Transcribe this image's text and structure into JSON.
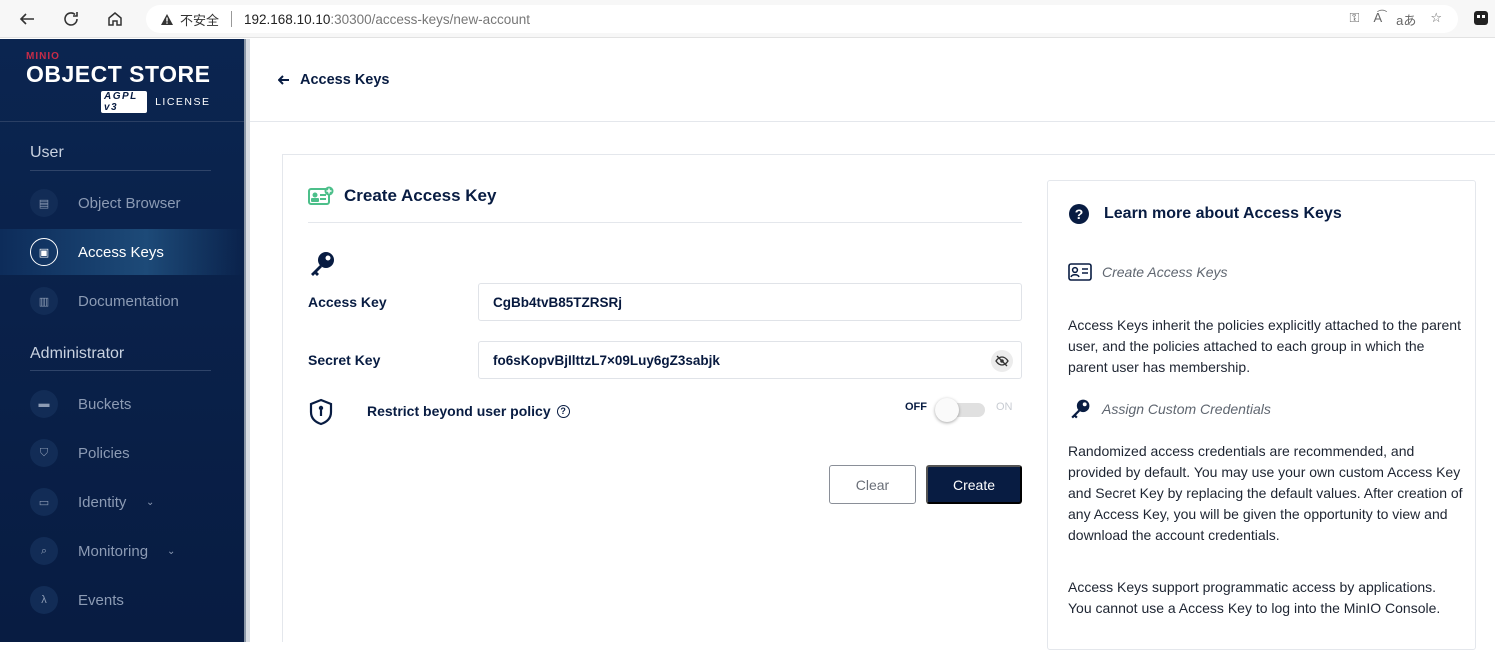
{
  "browser": {
    "security_label": "不安全",
    "url_host": "192.168.10.10",
    "url_path": ":30300/access-keys/new-account"
  },
  "brand": {
    "minio": "MINIO",
    "product": "OBJECT STORE",
    "license_badge": "AGPL v3",
    "license": "LICENSE"
  },
  "sidebar": {
    "user_section": "User",
    "user_items": [
      {
        "label": "Object Browser",
        "icon": "folder-icon"
      },
      {
        "label": "Access Keys",
        "icon": "id-card-icon",
        "active": true
      },
      {
        "label": "Documentation",
        "icon": "document-icon"
      }
    ],
    "admin_section": "Administrator",
    "admin_items": [
      {
        "label": "Buckets",
        "icon": "bucket-icon"
      },
      {
        "label": "Policies",
        "icon": "shield-icon"
      },
      {
        "label": "Identity",
        "icon": "identity-icon",
        "expandable": true
      },
      {
        "label": "Monitoring",
        "icon": "search-icon",
        "expandable": true
      },
      {
        "label": "Events",
        "icon": "lambda-icon"
      }
    ]
  },
  "header": {
    "back_label": "Access Keys"
  },
  "form": {
    "title": "Create Access Key",
    "access_key_label": "Access Key",
    "access_key_value": "CgBb4tvB85TZRSRj",
    "secret_key_label": "Secret Key",
    "secret_key_value": "fo6sKopvBjIlttzL7×09Luy6gZ3sabjk",
    "restrict_label": "Restrict beyond user policy",
    "toggle_off": "OFF",
    "toggle_on": "ON",
    "toggle_state": false,
    "clear_label": "Clear",
    "create_label": "Create"
  },
  "help": {
    "title": "Learn more about Access Keys",
    "sub1": "Create Access Keys",
    "para1": "Access Keys inherit the policies explicitly attached to the parent user, and the policies attached to each group in which the parent user has membership.",
    "sub2": "Assign Custom Credentials",
    "para2": "Randomized access credentials are recommended, and provided by default. You may use your own custom Access Key and Secret Key by replacing the default values. After creation of any Access Key, you will be given the opportunity to view and download the account credentials.",
    "para3": "Access Keys support programmatic access by applications. You cannot use a Access Key to log into the MinIO Console."
  },
  "colors": {
    "sidebar_bg": "#081c42",
    "brand_red": "#c72c48",
    "accent_green": "#4cbf8a"
  }
}
